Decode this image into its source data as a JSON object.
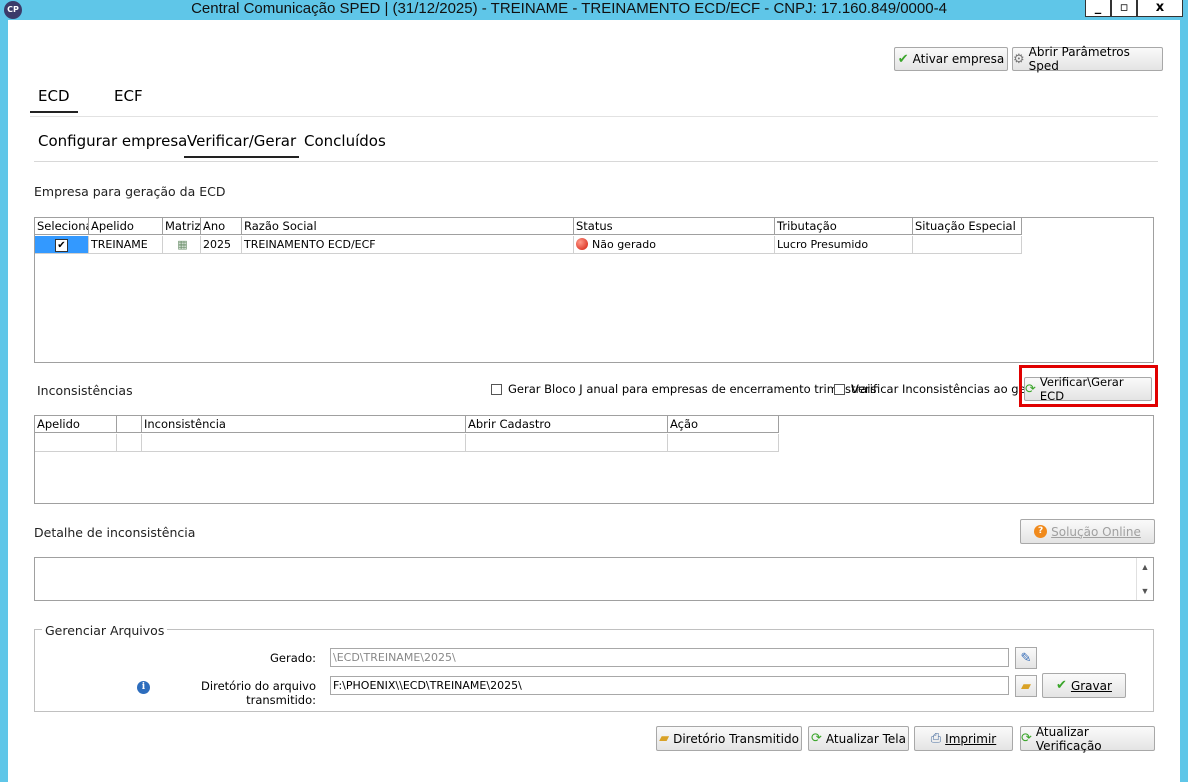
{
  "window": {
    "app_icon": "CP",
    "title": "Central Comunicação SPED | (31/12/2025) - TREINAME - TREINAMENTO ECD/ECF  - CNPJ: 17.160.849/0000-4",
    "min_icon": "minimize-icon",
    "max_icon": "maximize-icon",
    "close_icon": "close-icon"
  },
  "toolbar": {
    "activate_label": "Ativar empresa",
    "params_label": "Abrir Parâmetros Sped"
  },
  "main_tabs": [
    "ECD",
    "ECF"
  ],
  "sub_tabs": [
    "Configurar empresa",
    "Verificar/Gerar",
    "Concluídos"
  ],
  "companies": {
    "title": "Empresa para geração da ECD",
    "columns": [
      "Selecionar",
      "Apelido",
      "Matriz",
      "Ano",
      "Razão Social",
      "Status",
      "Tributação",
      "Situação Especial"
    ],
    "rows": [
      {
        "selected": "✔",
        "apelido": "TREINAME",
        "matriz_icon": "building-icon",
        "ano": "2025",
        "razao": "TREINAMENTO ECD/ECF",
        "status": "Não gerado",
        "status_color": "#d31a0a",
        "tributacao": "Lucro Presumido",
        "situacao": ""
      }
    ]
  },
  "inconsistencias": {
    "title": "Inconsistências",
    "bloco_j_label": "Gerar Bloco J anual para empresas de encerramento trimestrais",
    "verificar_label": "Verificar Inconsistências ao gerar",
    "button_label": "Verificar\\Gerar ECD",
    "columns": [
      "Apelido",
      "",
      "Inconsistência",
      "Abrir Cadastro",
      "Ação"
    ]
  },
  "detalhe": {
    "title": "Detalhe de inconsistência",
    "solucao_label": "Solução Online"
  },
  "arquivos": {
    "legend": "Gerenciar Arquivos",
    "gerado_label": "Gerado:",
    "gerado_value": "\\ECD\\TREINAME\\2025\\",
    "diretorio_label": "Diretório do arquivo transmitido:",
    "diretorio_value": "F:\\PHOENIX\\\\ECD\\TREINAME\\2025\\",
    "gravar_label": "Gravar"
  },
  "footer": {
    "diretorio_label": "Diretório Transmitido",
    "atualizar_tela_label": "Atualizar Tela",
    "imprimir_label": "Imprimir",
    "atualizar_verif_label": "Atualizar Verificação"
  },
  "colors": {
    "titlebar": "#5fc6e8",
    "highlight": "#e00000"
  }
}
